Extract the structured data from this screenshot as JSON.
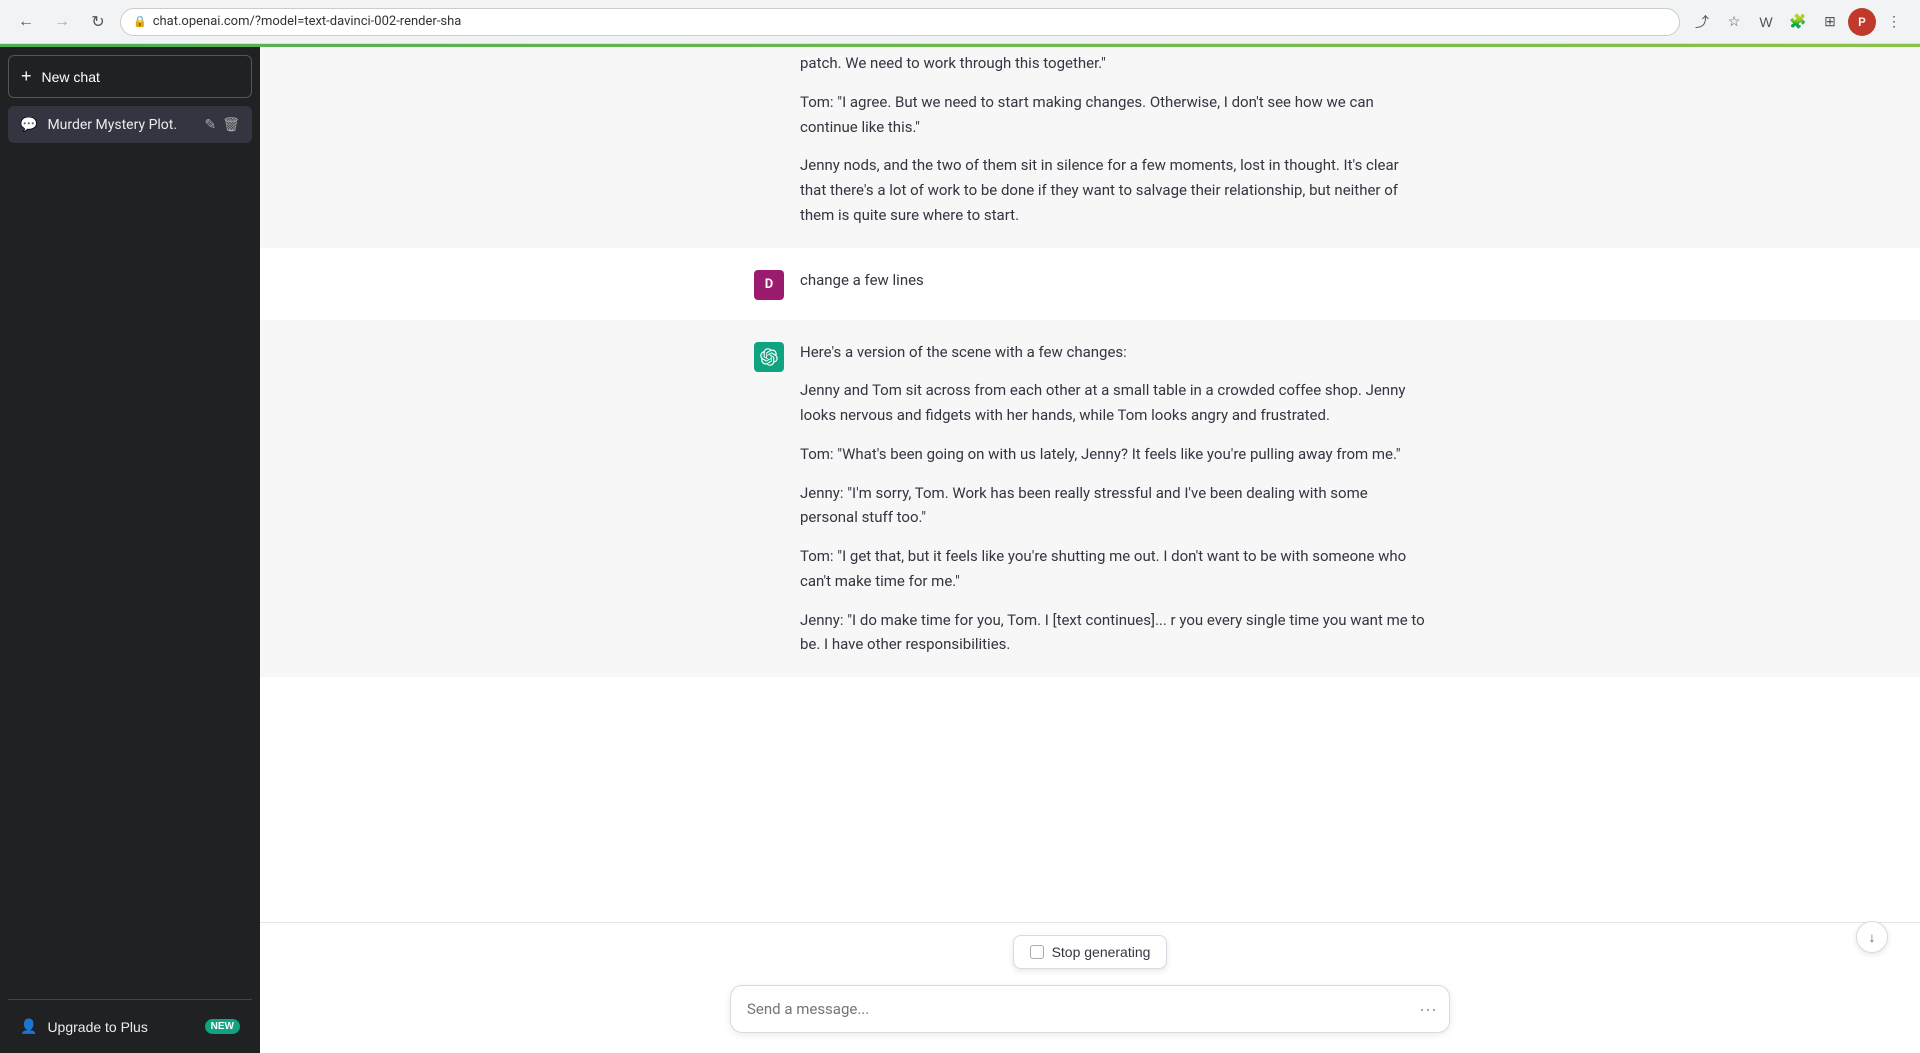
{
  "browser": {
    "url": "chat.openai.com/?model=text-davinci-002-render-sha",
    "back_disabled": false,
    "forward_disabled": true,
    "profile_initial": "P"
  },
  "sidebar": {
    "new_chat_label": "New chat",
    "chat_items": [
      {
        "label": "Murder Mystery Plot.",
        "icon": "chat-icon"
      }
    ],
    "footer": {
      "upgrade_label": "Upgrade to Plus",
      "upgrade_badge": "NEW"
    }
  },
  "messages": [
    {
      "type": "assistant_continuation",
      "paragraphs": [
        "patch. We need to work through this together.\"",
        "Tom: \"I agree. But we need to start making changes. Otherwise, I don't see how we can continue like this.\"",
        "Jenny nods, and the two of them sit in silence for a few moments, lost in thought. It's clear that there's a lot of work to be done if they want to salvage their relationship, but neither of them is quite sure where to start."
      ]
    },
    {
      "type": "user",
      "avatar_initial": "D",
      "text": "change a few lines"
    },
    {
      "type": "assistant",
      "paragraphs": [
        "Here's a version of the scene with a few changes:",
        "Jenny and Tom sit across from each other at a small table in a crowded coffee shop. Jenny looks nervous and fidgets with her hands, while Tom looks angry and frustrated.",
        "Tom: \"What's been going on with us lately, Jenny? It feels like you're pulling away from me.\"",
        "Jenny: \"I'm sorry, Tom. Work has been really stressful and I've been dealing with some personal stuff too.\"",
        "Tom: \"I get that, but it feels like you're shutting me out. I don't want to be with someone who can't make time for me.\"",
        "Jenny: \"I do make time for you, Tom. I [text continues]... r you every single time you want me to be. I have other responsibilities."
      ]
    }
  ],
  "input": {
    "placeholder": "Send a message..."
  },
  "stop_generating": {
    "label": "Stop generating"
  },
  "icons": {
    "back": "←",
    "forward": "→",
    "reload": "↻",
    "star": "☆",
    "share": "⤴",
    "more": "⋮",
    "chat": "💬",
    "edit": "✎",
    "trash": "🗑",
    "user": "👤",
    "plus": "+",
    "down_arrow": "↓",
    "ellipsis": "···"
  }
}
